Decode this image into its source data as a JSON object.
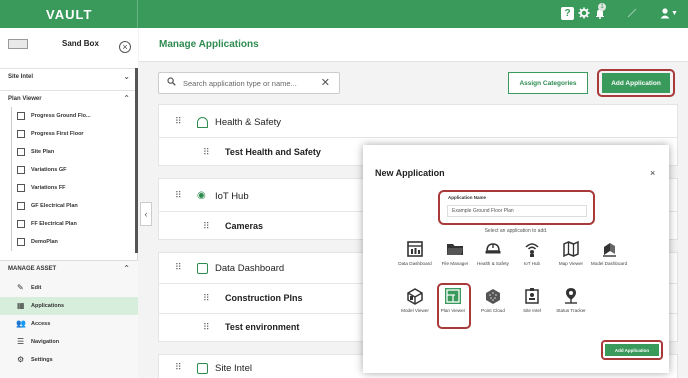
{
  "topbar": {
    "brand": "VAULT",
    "help_icon_glyph": "?",
    "notification_count": "1",
    "accent": "#3a9a5c"
  },
  "sidebar": {
    "title": "Sand Box",
    "sections": {
      "site_intel": "Site Intel",
      "plan_viewer": "Plan Viewer"
    },
    "plan_items": [
      {
        "label": "Progress Ground Flo...",
        "icon": "plan-icon"
      },
      {
        "label": "Progress First Floor",
        "icon": "plan-icon"
      },
      {
        "label": "Site Plan",
        "icon": "plan-icon"
      },
      {
        "label": "Variations GF",
        "icon": "plan-icon"
      },
      {
        "label": "Variations FF",
        "icon": "plan-icon"
      },
      {
        "label": "GF Electrical Plan",
        "icon": "plan-icon"
      },
      {
        "label": "FF Electrical Plan",
        "icon": "plan-icon"
      },
      {
        "label": "DemoPlan",
        "icon": "plan-icon"
      }
    ],
    "manage_asset": {
      "heading": "MANAGE ASSET",
      "items": [
        {
          "label": "Edit",
          "icon": "pencil-icon"
        },
        {
          "label": "Applications",
          "icon": "grid-icon"
        },
        {
          "label": "Access",
          "icon": "people-icon"
        },
        {
          "label": "Navigation",
          "icon": "list-icon"
        },
        {
          "label": "Settings",
          "icon": "gear-icon"
        }
      ]
    }
  },
  "main": {
    "title": "Manage Applications",
    "search_placeholder": "Search application type or name...",
    "assign_categories_label": "Assign Categories",
    "add_application_label": "Add Application",
    "groups": [
      {
        "label": "Health & Safety",
        "icon": "hardhat-icon",
        "children": [
          "Test Health and Safety"
        ]
      },
      {
        "label": "IoT Hub",
        "icon": "iot-icon",
        "children": [
          "Cameras"
        ]
      },
      {
        "label": "Data Dashboard",
        "icon": "dashboard-icon",
        "children": [
          "Construction Plns",
          "Test environment"
        ]
      },
      {
        "label": "Site Intel",
        "icon": "siteintel-icon",
        "children": []
      }
    ]
  },
  "modal": {
    "title": "New Application",
    "close_glyph": "×",
    "name_label": "Application Name",
    "name_value": "Example Ground Floor Plan",
    "select_hint": "Select an application to add.",
    "apps_row1": [
      {
        "label": "Data Dashboard",
        "icon": "data-dashboard-icon"
      },
      {
        "label": "File Manager",
        "icon": "folder-icon"
      },
      {
        "label": "Health & Safety",
        "icon": "hardhat-icon"
      },
      {
        "label": "IoT Hub",
        "icon": "iot-icon"
      },
      {
        "label": "Map Viewer",
        "icon": "map-icon"
      },
      {
        "label": "Model Dashboard",
        "icon": "model-dashboard-icon"
      }
    ],
    "apps_row2": [
      {
        "label": "Model Viewer",
        "icon": "model-viewer-icon"
      },
      {
        "label": "Plan Viewer",
        "icon": "plan-viewer-icon"
      },
      {
        "label": "Point Cloud",
        "icon": "point-cloud-icon"
      },
      {
        "label": "Site Intel",
        "icon": "site-intel-icon"
      },
      {
        "label": "Status Tracker",
        "icon": "status-tracker-icon"
      }
    ],
    "add_label": "Add Application"
  }
}
